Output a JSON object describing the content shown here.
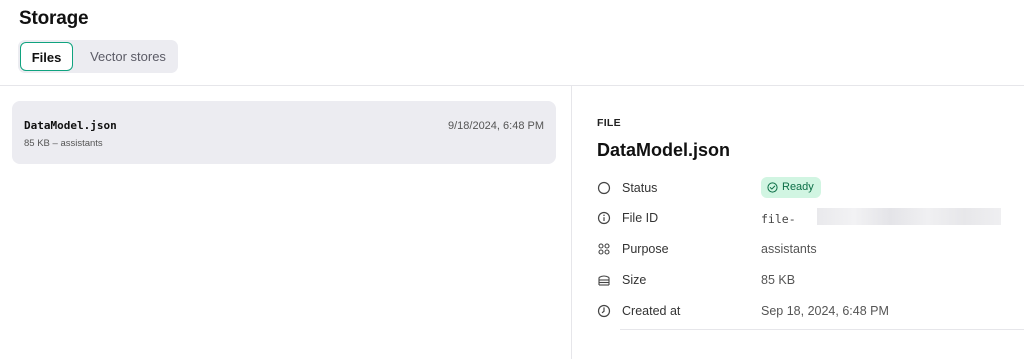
{
  "page": {
    "title": "Storage"
  },
  "tabs": [
    {
      "label": "Files",
      "active": true
    },
    {
      "label": "Vector stores",
      "active": false
    }
  ],
  "file_list": [
    {
      "name": "DataModel.json",
      "meta": "85 KB – assistants",
      "date": "9/18/2024, 6:48 PM"
    }
  ],
  "detail": {
    "kicker": "FILE",
    "title": "DataModel.json",
    "props": {
      "status": {
        "label": "Status",
        "value": "Ready",
        "icon": "circle-icon"
      },
      "file_id": {
        "label": "File ID",
        "value": "file-",
        "icon": "info-icon"
      },
      "purpose": {
        "label": "Purpose",
        "value": "assistants",
        "icon": "grid-icon"
      },
      "size": {
        "label": "Size",
        "value": "85 KB",
        "icon": "database-icon"
      },
      "created": {
        "label": "Created at",
        "value": "Sep 18, 2024, 6:48 PM",
        "icon": "clock-icon"
      }
    }
  },
  "colors": {
    "accent": "#10a37f",
    "badge_bg": "#d1f5e2",
    "badge_text": "#0b6e46",
    "selected_row": "#ececf1"
  }
}
